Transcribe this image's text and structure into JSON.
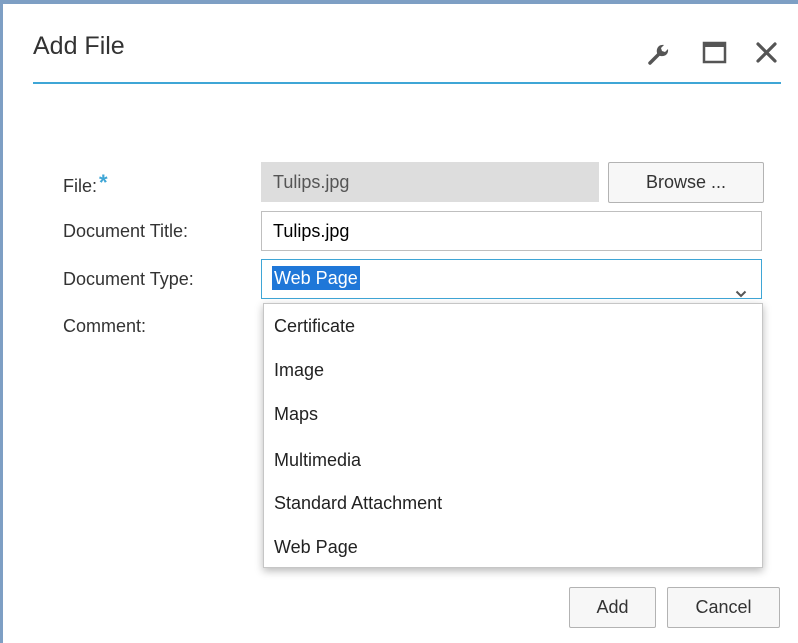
{
  "dialog": {
    "title": "Add File",
    "header_icons": [
      "wrench-icon",
      "maximize-icon",
      "close-icon"
    ]
  },
  "form": {
    "file": {
      "label": "File:",
      "required_marker": "*",
      "value": "Tulips.jpg",
      "browse_label": "Browse ..."
    },
    "document_title": {
      "label": "Document Title:",
      "value": "Tulips.jpg"
    },
    "document_type": {
      "label": "Document Type:",
      "value": "Web Page",
      "options": [
        "Certificate",
        "Image",
        "Maps",
        "Multimedia",
        "Standard Attachment",
        "Web Page"
      ]
    },
    "comment": {
      "label": "Comment:"
    }
  },
  "footer": {
    "add_label": "Add",
    "cancel_label": "Cancel"
  },
  "colors": {
    "accent": "#3fa6d6",
    "selection": "#1f77d8",
    "window_border": "#7e9fc4"
  }
}
